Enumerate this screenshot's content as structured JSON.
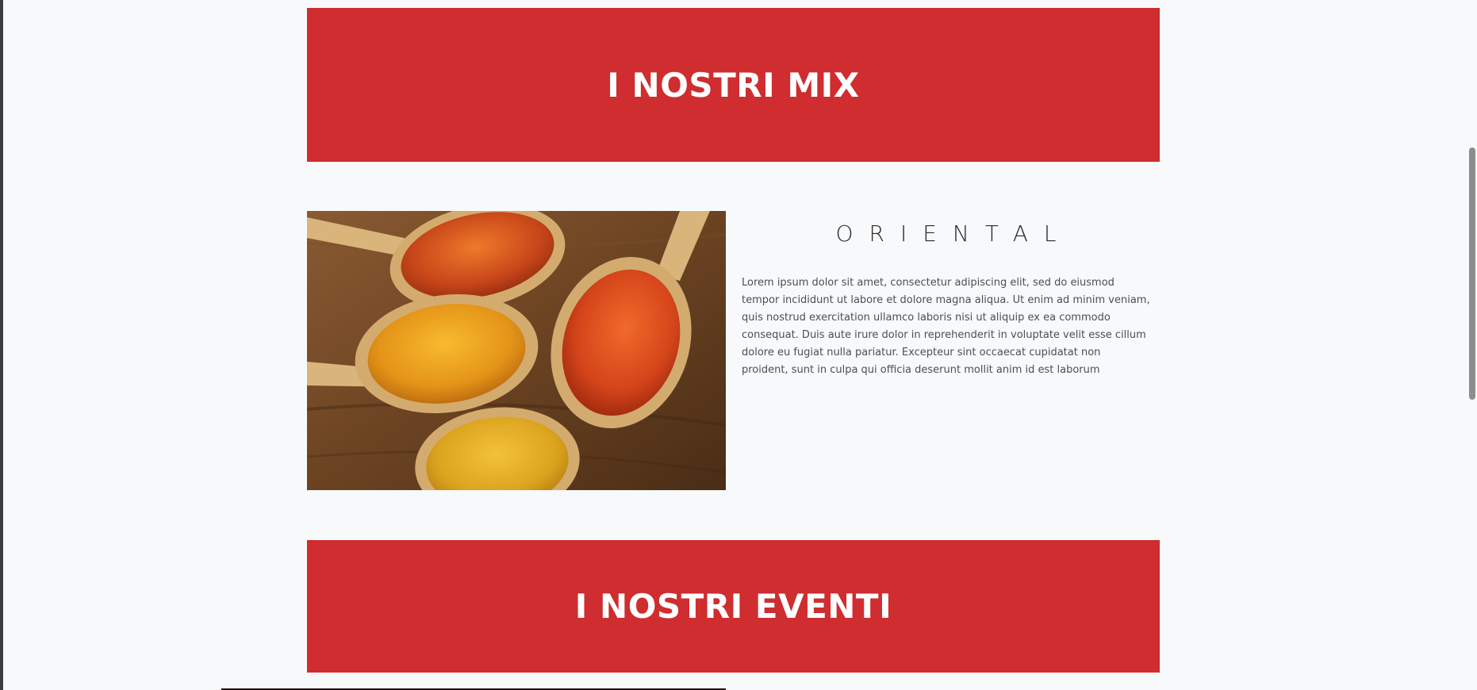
{
  "sections": {
    "mix": {
      "title": "I NOSTRI MIX"
    },
    "eventi": {
      "title": "I NOSTRI EVENTI"
    }
  },
  "product": {
    "title": "ORIENTAL",
    "description": "Lorem ipsum dolor sit amet, consectetur adipiscing elit, sed do eiusmod tempor incididunt ut labore et dolore magna aliqua. Ut enim ad minim veniam, quis nostrud exercitation ullamco laboris nisi ut aliquip ex ea commodo consequat. Duis aute irure dolor in reprehenderit in voluptate velit esse cillum dolore eu fugiat nulla pariatur. Excepteur sint occaecat cupidatat non proident, sunt in culpa qui officia deserunt mollit anim id est laborum",
    "image_icon": "spice-spoons-photo"
  },
  "colors": {
    "banner": "#cf2d2f",
    "page_background": "#f8f9fa"
  }
}
